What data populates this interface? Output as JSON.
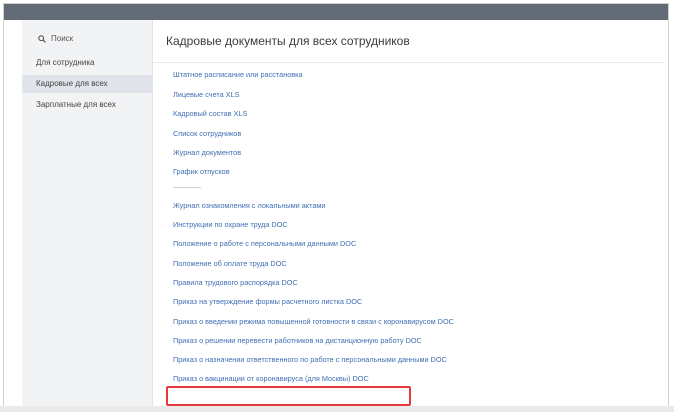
{
  "sidebar": {
    "search_label": "Поиск",
    "items": [
      {
        "label": "Для сотрудника"
      },
      {
        "label": "Кадровые для всех"
      },
      {
        "label": "Зарплатные для всех"
      }
    ]
  },
  "main": {
    "title": "Кадровые документы для всех сотрудников",
    "group1": [
      "Штатное расписание или расстановка",
      "Лицевые счета XLS",
      "Кадровый состав XLS",
      "Список сотрудников",
      "Журнал документов",
      "График отпусков"
    ],
    "group2": [
      "Журнал ознакомления с локальными актами",
      "Инструкции по охране труда DOC",
      "Положение о работе с персональными данными DOC",
      "Положение об оплате труда DOC",
      "Правила трудового распорядка DOC",
      "Приказ на утверждение формы расчетного листка DOC",
      "Приказ о введении режима повышенной готовности в связи с коронавирусом DOC",
      "Приказ о решении перевести работников на дистанционную работу DOC",
      "Приказ о назначении ответственного по работе с персональными данными DOC",
      "Приказ о вакцинации от коронавируса (для Москвы) DOC"
    ]
  },
  "colors": {
    "link": "#3f6fb4",
    "highlight": "#e53b3b",
    "sidebar_bg": "#f2f3f5",
    "top_band": "#626a76"
  }
}
